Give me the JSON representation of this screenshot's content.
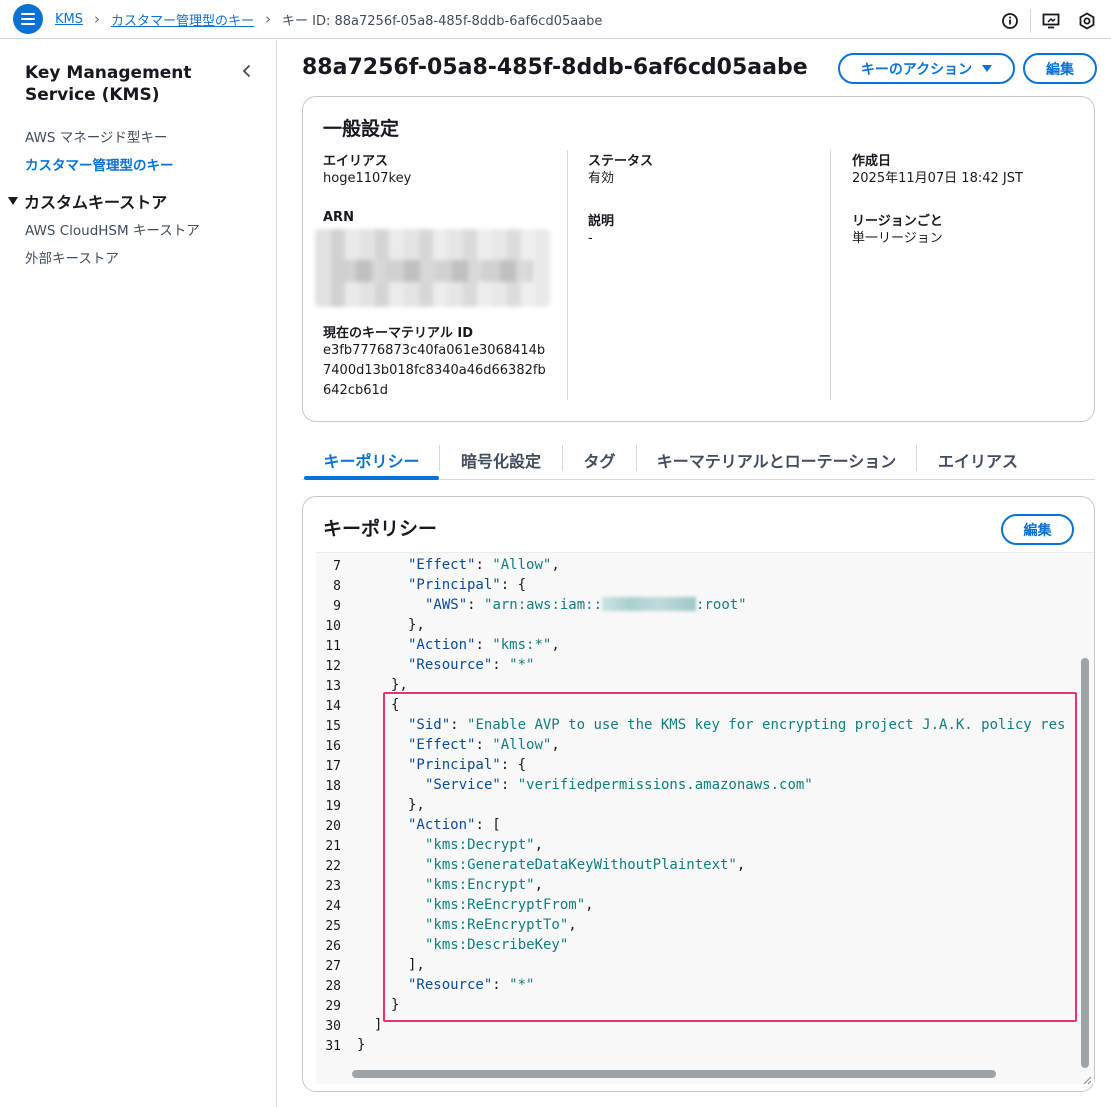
{
  "breadcrumb": {
    "items": [
      "KMS",
      "カスタマー管理型のキー"
    ],
    "current": "キー ID: 88a7256f-05a8-485f-8ddb-6af6cd05aabe"
  },
  "topbar_icons": [
    "info-icon",
    "screen-icon",
    "settings-hex-icon"
  ],
  "sidebar": {
    "title_line1": "Key Management",
    "title_line2": "Service (KMS)",
    "links": [
      "AWS マネージド型キー",
      "カスタマー管理型のキー"
    ],
    "active_link": "カスタマー管理型のキー",
    "section": "カスタムキーストア",
    "section_links": [
      "AWS CloudHSM キーストア",
      "外部キーストア"
    ]
  },
  "page": {
    "title": "88a7256f-05a8-485f-8ddb-6af6cd05aabe",
    "actions_button": "キーのアクション",
    "edit_button": "編集"
  },
  "general": {
    "title": "一般設定",
    "alias_label": "エイリアス",
    "alias_value": "hoge1107key",
    "arn_label": "ARN",
    "key_material_label": "現在のキーマテリアル ID",
    "key_material_lines": [
      "e3fb7776873c40fa061e3068414b",
      "7400d13b018fc8340a46d66382fb",
      "642cb61d"
    ],
    "status_label": "ステータス",
    "status_value": "有効",
    "description_label": "説明",
    "description_value": "-",
    "created_label": "作成日",
    "created_value": "2025年11月07日 18:42 JST",
    "region_label": "リージョンごと",
    "region_value": "単一リージョン"
  },
  "tabs": [
    "キーポリシー",
    "暗号化設定",
    "タグ",
    "キーマテリアルとローテーション",
    "エイリアス"
  ],
  "active_tab": "キーポリシー",
  "policy": {
    "title": "キーポリシー",
    "edit_button": "編集",
    "line_numbers": [
      "7",
      "8",
      "9",
      "10",
      "11",
      "12",
      "13",
      "14",
      "15",
      "16",
      "17",
      "18",
      "19",
      "20",
      "21",
      "22",
      "23",
      "24",
      "25",
      "26",
      "27",
      "28",
      "29",
      "30",
      "31"
    ],
    "code": {
      "l7_key": "\"Effect\"",
      "l7_val": "\"Allow\"",
      "l8_key": "\"Principal\"",
      "l9_key": "\"AWS\"",
      "l9_val_a": "\"arn:aws:iam::",
      "l9_val_b": ":root\"",
      "l10": "},",
      "l11_key": "\"Action\"",
      "l11_val": "\"kms:*\"",
      "l12_key": "\"Resource\"",
      "l12_val": "\"*\"",
      "l13": "},",
      "l14": "{",
      "l15_key": "\"Sid\"",
      "l15_val": "\"Enable AVP to use the KMS key for encrypting project J.A.K. policy res",
      "l16_key": "\"Effect\"",
      "l16_val": "\"Allow\"",
      "l17_key": "\"Principal\"",
      "l18_key": "\"Service\"",
      "l18_val": "\"verifiedpermissions.amazonaws.com\"",
      "l19": "},",
      "l20_key": "\"Action\"",
      "l21": "\"kms:Decrypt\"",
      "l22": "\"kms:GenerateDataKeyWithoutPlaintext\"",
      "l23": "\"kms:Encrypt\"",
      "l24": "\"kms:ReEncryptFrom\"",
      "l25": "\"kms:ReEncryptTo\"",
      "l26": "\"kms:DescribeKey\"",
      "l27": "],",
      "l28_key": "\"Resource\"",
      "l28_val": "\"*\"",
      "l29": "}",
      "l30": "]",
      "l31": "}"
    }
  },
  "colors": {
    "accent": "#0972d3",
    "highlight_border": "#e8336b",
    "code_key": "#0a4a99",
    "code_string": "#0f7e7e"
  }
}
